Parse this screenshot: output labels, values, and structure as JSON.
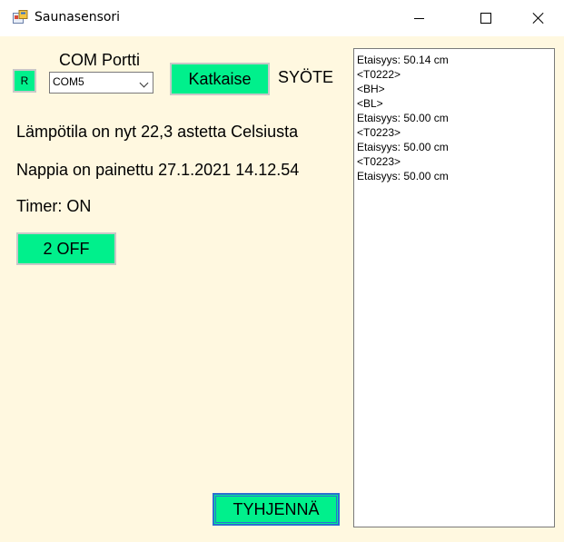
{
  "window": {
    "title": "Saunasensori"
  },
  "controls": {
    "r_button_label": "R",
    "com_label": "COM Portti",
    "com_selected": "COM5",
    "disconnect_label": "Katkaise",
    "input_label": "SYÖTE",
    "off_button_label": "2 OFF",
    "clear_button_label": "TYHJENNÄ"
  },
  "status": {
    "temperature": "Lämpötila on nyt 22,3 astetta Celsiusta",
    "button_pressed": "Nappia on painettu 27.1.2021 14.12.54",
    "timer": "Timer: ON"
  },
  "log": [
    "Etaisyys: 50.14 cm",
    "<T0222>",
    "<BH>",
    "<BL>",
    "Etaisyys: 50.00 cm",
    "<T0223>",
    "Etaisyys: 50.00 cm",
    "<T0223>",
    "Etaisyys: 50.00 cm"
  ],
  "colors": {
    "button_green": "#00f08c",
    "client_background": "#fff8e0",
    "focus_border": "#2c6fd1"
  }
}
